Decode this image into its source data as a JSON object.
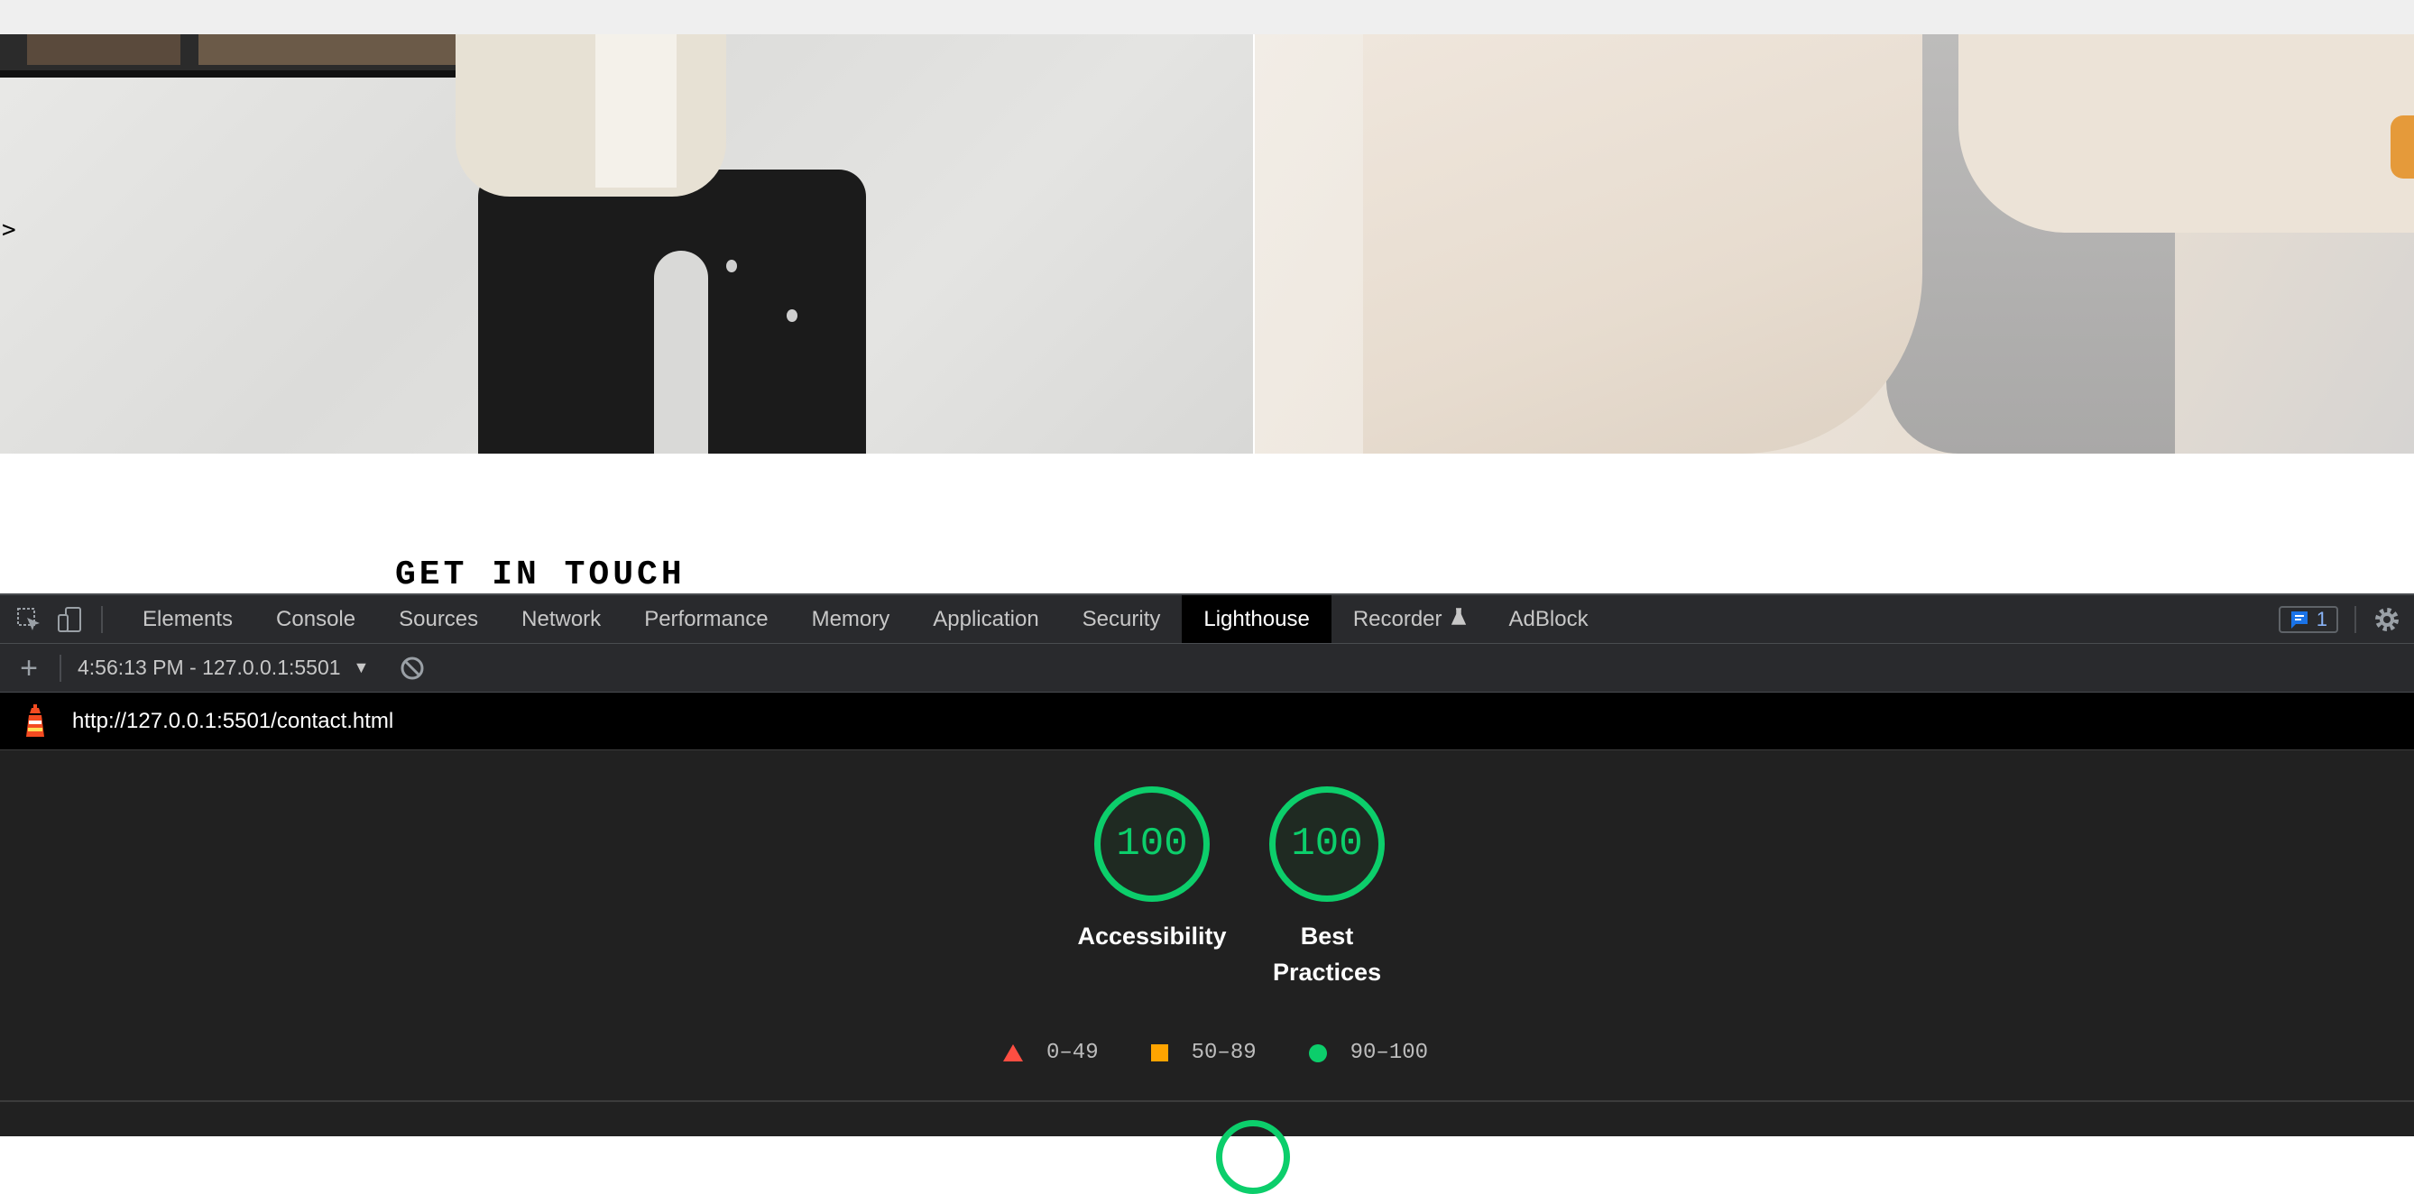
{
  "webpage": {
    "carousel_arrow": ">",
    "heading": "GET IN TOUCH"
  },
  "devtools": {
    "tabs": [
      "Elements",
      "Console",
      "Sources",
      "Network",
      "Performance",
      "Memory",
      "Application",
      "Security",
      "Lighthouse",
      "Recorder",
      "AdBlock"
    ],
    "active_tab": "Lighthouse",
    "recorder_flask_icon": "flask-icon",
    "issues_count": "1",
    "toolbar": {
      "add_label": "+",
      "report_select": "4:56:13 PM - 127.0.0.1:5501",
      "caret": "▼"
    },
    "url": "http://127.0.0.1:5501/contact.html",
    "scores": [
      {
        "value": "100",
        "label": "Accessibility"
      },
      {
        "value": "100",
        "label": "Best Practices"
      }
    ],
    "legend": [
      {
        "range": "0–49",
        "color": "#ff4e42",
        "shape": "triangle"
      },
      {
        "range": "50–89",
        "color": "#ffa400",
        "shape": "square"
      },
      {
        "range": "90–100",
        "color": "#0cce6b",
        "shape": "circle"
      }
    ]
  }
}
